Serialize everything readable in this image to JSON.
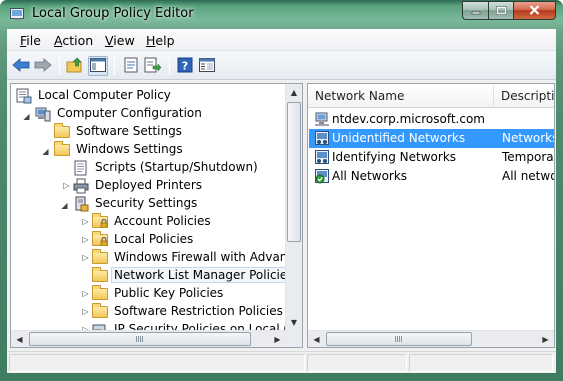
{
  "window": {
    "title": "Local Group Policy Editor",
    "icons": {
      "app": "group-policy-icon",
      "minimize": "minimize-icon",
      "maximize": "maximize-icon",
      "close": "close-icon"
    }
  },
  "menu": {
    "items": [
      {
        "label": "File",
        "accel": "F",
        "rest": "ile"
      },
      {
        "label": "Action",
        "accel": "A",
        "rest": "ction"
      },
      {
        "label": "View",
        "accel": "V",
        "rest": "iew"
      },
      {
        "label": "Help",
        "accel": "H",
        "rest": "elp"
      }
    ]
  },
  "toolbar": {
    "buttons": [
      "back-arrow-icon",
      "forward-arrow-icon",
      "up-folder-icon",
      "show-hide-console-tree-icon",
      "properties-icon",
      "export-list-icon",
      "help-icon",
      "extended-view-icon"
    ]
  },
  "tree": {
    "items": [
      {
        "label": "Local Computer Policy",
        "icon": "computer-policy-icon",
        "expander": ""
      },
      {
        "label": "Computer Configuration",
        "icon": "computer-icon",
        "expander": "expanded"
      },
      {
        "label": "Software Settings",
        "icon": "folder-icon",
        "expander": ""
      },
      {
        "label": "Windows Settings",
        "icon": "folder-icon",
        "expander": "expanded"
      },
      {
        "label": "Scripts (Startup/Shutdown)",
        "icon": "script-icon",
        "expander": ""
      },
      {
        "label": "Deployed Printers",
        "icon": "printer-icon",
        "expander": "collapsed"
      },
      {
        "label": "Security Settings",
        "icon": "security-settings-icon",
        "expander": "expanded"
      },
      {
        "label": "Account Policies",
        "icon": "folder-lock-icon",
        "expander": "collapsed"
      },
      {
        "label": "Local Policies",
        "icon": "folder-lock-icon",
        "expander": "collapsed"
      },
      {
        "label": "Windows Firewall with Advanced",
        "icon": "folder-icon",
        "expander": "collapsed"
      },
      {
        "label": "Network List Manager Policies",
        "icon": "folder-icon",
        "expander": "",
        "selected": true
      },
      {
        "label": "Public Key Policies",
        "icon": "folder-icon",
        "expander": "collapsed"
      },
      {
        "label": "Software Restriction Policies",
        "icon": "folder-icon",
        "expander": "collapsed"
      },
      {
        "label": "IP Security Policies on Local Com",
        "icon": "ip-security-icon",
        "expander": "collapsed"
      }
    ]
  },
  "list": {
    "columns": [
      "Network Name",
      "Description"
    ],
    "rows": [
      {
        "name": "ntdev.corp.microsoft.com",
        "description": "",
        "icon": "domain-network-icon"
      },
      {
        "name": "Unidentified Networks",
        "description": "Networks t",
        "icon": "unidentified-network-icon",
        "selected": true
      },
      {
        "name": "Identifying Networks",
        "description": "Temporary",
        "icon": "identifying-network-icon"
      },
      {
        "name": "All Networks",
        "description": "All networl",
        "icon": "all-networks-icon"
      }
    ]
  },
  "colors": {
    "frame": "#4e8a6e",
    "selection": "#3399ff",
    "close_button": "#c44a2a"
  }
}
